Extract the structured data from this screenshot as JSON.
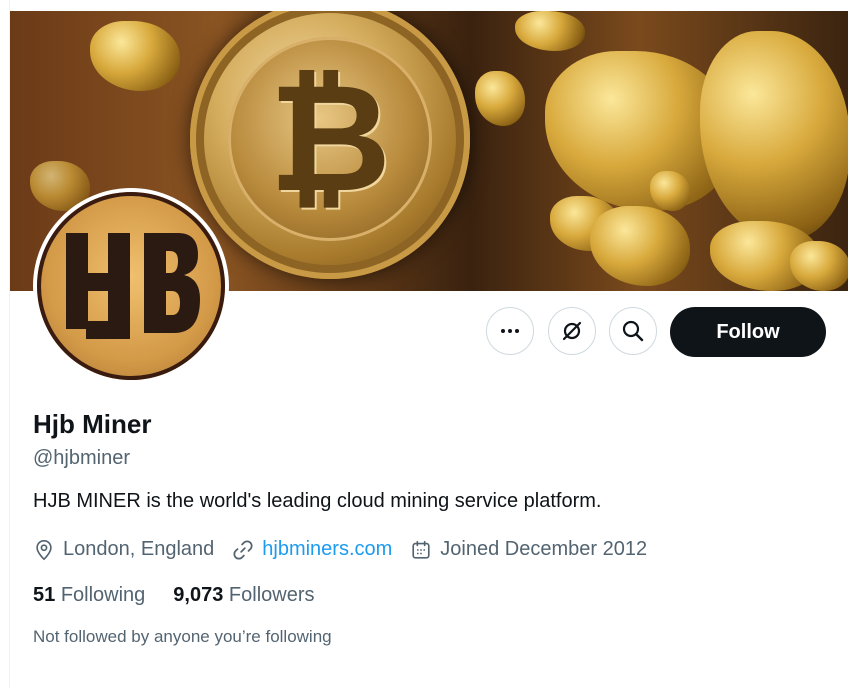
{
  "profile": {
    "name": "Hjb Miner",
    "handle": "@hjbminer",
    "bio": "HJB MINER is the world's leading cloud mining service platform.",
    "location": "London, England",
    "website": "hjbminers.com",
    "joined": "Joined December 2012",
    "following_count": "51",
    "following_label": "Following",
    "followers_count": "9,073",
    "followers_label": "Followers",
    "not_followed_note": "Not followed by anyone you’re following"
  },
  "actions": {
    "follow_label": "Follow",
    "more_icon": "more-horizontal-icon",
    "grok_icon": "grok-icon",
    "search_icon": "search-icon"
  },
  "colors": {
    "accent_link": "#1d9bf0",
    "follow_button_bg": "#0f1419",
    "secondary_text": "#536471"
  }
}
